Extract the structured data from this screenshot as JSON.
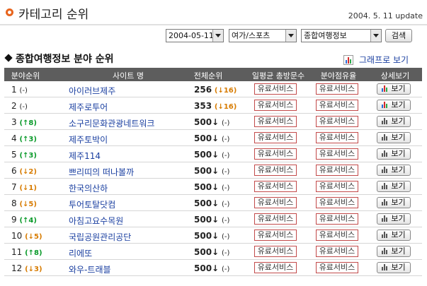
{
  "header": {
    "title": "카테고리 순위",
    "update": "2004. 5. 11 update"
  },
  "toolbar": {
    "date_select": "2004-05-11",
    "category_select": "여가/스포츠",
    "subcategory_select": "종합여행정보",
    "search_label": "검색"
  },
  "section": {
    "title": "종합여행정보 분야 순위",
    "graph_link": "그래프로 보기"
  },
  "table": {
    "headers": {
      "rank": "분야순위",
      "site": "사이트 명",
      "total": "전체순위",
      "visitors": "일평균 총방문수",
      "share": "분야점유율",
      "detail": "상세보기"
    },
    "paid_label": "유료서비스",
    "view_label": "보기",
    "rows": [
      {
        "rank": "1",
        "rank_change": "(-)",
        "site": "아이러브제주",
        "total": "256",
        "total_change": "(↓16)"
      },
      {
        "rank": "2",
        "rank_change": "(-)",
        "site": "제주로투어",
        "total": "353",
        "total_change": "(↓16)"
      },
      {
        "rank": "3",
        "rank_change": "(↑8)",
        "site": "소구리문화관광네트워크",
        "total": "500↓",
        "total_change": "(-)"
      },
      {
        "rank": "4",
        "rank_change": "(↑3)",
        "site": "제주토박이",
        "total": "500↓",
        "total_change": "(-)"
      },
      {
        "rank": "5",
        "rank_change": "(↑3)",
        "site": "제주114",
        "total": "500↓",
        "total_change": "(-)"
      },
      {
        "rank": "6",
        "rank_change": "(↓2)",
        "site": "쁘리띠의 떠나볼까",
        "total": "500↓",
        "total_change": "(-)"
      },
      {
        "rank": "7",
        "rank_change": "(↓1)",
        "site": "한국의산하",
        "total": "500↓",
        "total_change": "(-)"
      },
      {
        "rank": "8",
        "rank_change": "(↓5)",
        "site": "투어토탈닷컴",
        "total": "500↓",
        "total_change": "(-)"
      },
      {
        "rank": "9",
        "rank_change": "(↑4)",
        "site": "아침고요수목원",
        "total": "500↓",
        "total_change": "(-)"
      },
      {
        "rank": "10",
        "rank_change": "(↓5)",
        "site": "국립공원관리공단",
        "total": "500↓",
        "total_change": "(-)"
      },
      {
        "rank": "11",
        "rank_change": "(↑8)",
        "site": "리에또",
        "total": "500↓",
        "total_change": "(-)"
      },
      {
        "rank": "12",
        "rank_change": "(↓3)",
        "site": "와우-트래블",
        "total": "500↓",
        "total_change": "(-)"
      }
    ]
  },
  "colors": {
    "accent": "#e8651e",
    "header_bg": "#5d5d5d",
    "link": "#1a3fa0",
    "rank_up": "#0a9a2a",
    "rank_down": "#d77b00",
    "paid_border": "#c24a4a"
  },
  "icons": {
    "section_marker": "diamond-icon",
    "header_marker": "ring-icon",
    "graph": "bar-chart-icon"
  }
}
